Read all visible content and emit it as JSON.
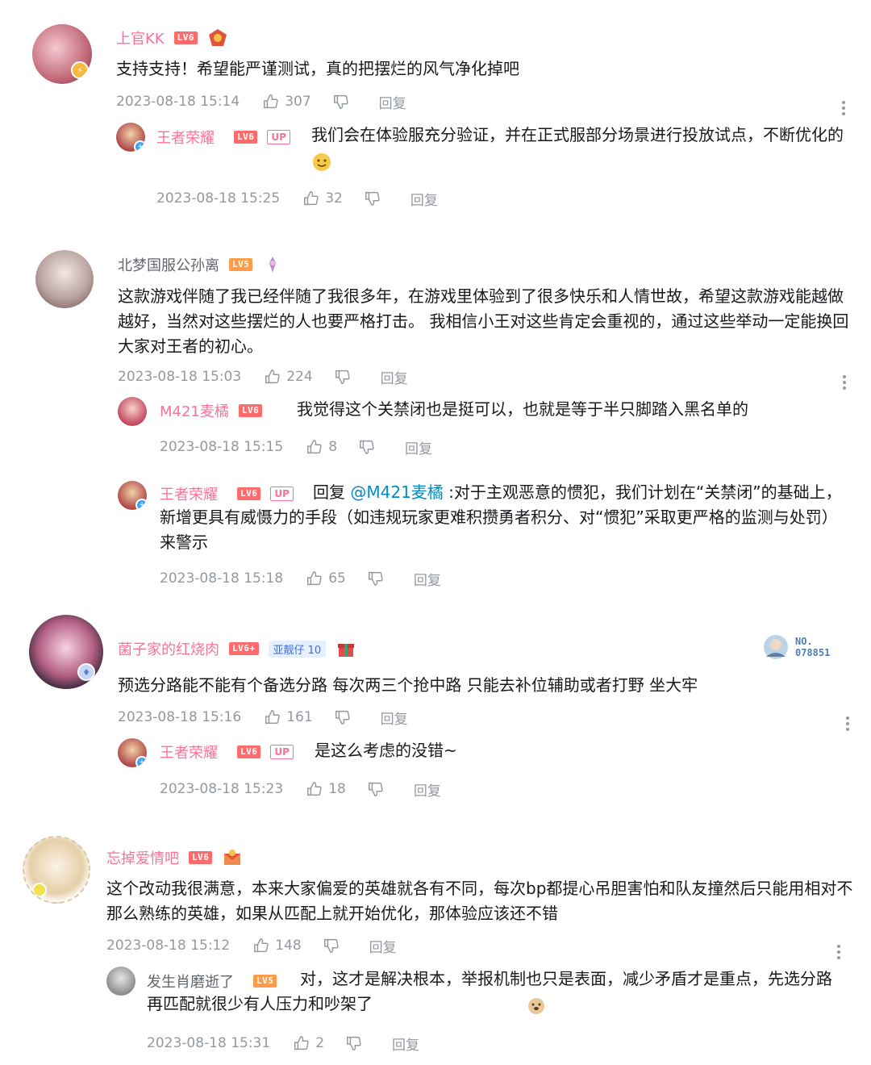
{
  "comments": [
    {
      "user": "上官KK",
      "level": "LV6",
      "text": "支持支持！希望能严谨测试，真的把摆烂的风气净化掉吧",
      "date": "2023-08-18 15:14",
      "likes": "307",
      "reply_label": "回复",
      "replies": [
        {
          "user": "王者荣耀",
          "level": "LV6",
          "tag": "UP",
          "text": "我们会在体验服充分验证，并在正式服部分场景进行投放试点，不断优化的",
          "date": "2023-08-18 15:25",
          "likes": "32",
          "reply_label": "回复"
        }
      ]
    },
    {
      "user": "北梦国服公孙离",
      "level": "LV5",
      "text": "这款游戏伴随了我已经伴随了我很多年，在游戏里体验到了很多快乐和人情世故，希望这款游戏能越做越好，当然对这些摆烂的人也要严格打击。 我相信小王对这些肯定会重视的，通过这些举动一定能换回大家对王者的初心。",
      "date": "2023-08-18 15:03",
      "likes": "224",
      "reply_label": "回复",
      "replies": [
        {
          "user": "M421麦橘",
          "level": "LV6",
          "text": "我觉得这个关禁闭也是挺可以，也就是等于半只脚踏入黑名单的",
          "date": "2023-08-18 15:15",
          "likes": "8",
          "reply_label": "回复"
        },
        {
          "user": "王者荣耀",
          "level": "LV6",
          "tag": "UP",
          "reply_prefix": "回复 ",
          "mention": "@M421麦橘",
          "text": " :对于主观恶意的惯犯，我们计划在“关禁闭”的基础上，新增更具有威慑力的手段（如违规玩家更难积攒勇者积分、对“惯犯”采取更严格的监测与处罚）来警示",
          "date": "2023-08-18 15:18",
          "likes": "65",
          "reply_label": "回复"
        }
      ]
    },
    {
      "user": "菌子家的红烧肉",
      "level": "LV6+",
      "fan_tag": "亚靓仔 10",
      "card_no": "NO.\n078851",
      "text": "预选分路能不能有个备选分路 每次两三个抢中路 只能去补位辅助或者打野 坐大牢",
      "date": "2023-08-18 15:16",
      "likes": "161",
      "reply_label": "回复",
      "replies": [
        {
          "user": "王者荣耀",
          "level": "LV6",
          "tag": "UP",
          "text": "是这么考虑的没错~",
          "date": "2023-08-18 15:23",
          "likes": "18",
          "reply_label": "回复"
        }
      ]
    },
    {
      "user": "忘掉爱情吧",
      "level": "LV6",
      "text": "这个改动我很满意，本来大家偏爱的英雄就各有不同，每次bp都提心吊胆害怕和队友撞然后只能用相对不那么熟练的英雄，如果从匹配上就开始优化，那体验应该还不错",
      "date": "2023-08-18 15:12",
      "likes": "148",
      "reply_label": "回复",
      "replies": [
        {
          "user": "发生肖磨逝了",
          "level": "LV5",
          "text": "对，这才是解决根本，举报机制也只是表面，减少矛盾才是重点，先选分路再匹配就很少有人压力和吵架了",
          "date": "2023-08-18 15:31",
          "likes": "2",
          "reply_label": "回复"
        }
      ]
    }
  ],
  "colors": {
    "accent": "#fb7299",
    "lv6": "#ff6b6b",
    "lv5": "#ff9c4a",
    "meta": "#9499a0",
    "mention": "#008ac5"
  }
}
